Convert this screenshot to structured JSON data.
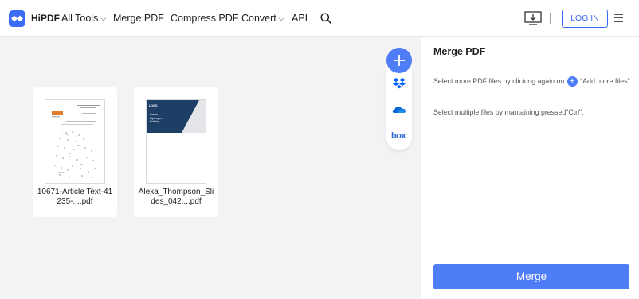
{
  "header": {
    "brand": "HiPDF",
    "nav": [
      {
        "label": "All Tools",
        "dropdown": true
      },
      {
        "label": "Merge PDF",
        "dropdown": false
      },
      {
        "label": "Compress PDF",
        "dropdown": false
      },
      {
        "label": "Convert",
        "dropdown": true
      },
      {
        "label": "API",
        "dropdown": false
      }
    ],
    "login_label": "LOG IN"
  },
  "files": [
    {
      "name": "10671-Article Text-41235-....pdf",
      "thumbnail": "document-page"
    },
    {
      "name": "Alexa_Thompson_Slides_042....pdf",
      "thumbnail": "presentation-slide",
      "slide_logo": "LOGO",
      "slide_title": "Green Hydrogen Briefing"
    }
  ],
  "upload_sources": [
    "add-more-files",
    "dropbox",
    "onedrive",
    "box"
  ],
  "upload_labels": {
    "box": "box"
  },
  "panel": {
    "title": "Merge PDF",
    "hint1_before": "Select more PDF files by clicking again on",
    "hint1_after": "\"Add more files\".",
    "hint2": "Select multiple files by mantaining pressed\"Ctrl\".",
    "merge_label": "Merge"
  },
  "colors": {
    "accent": "#4f7cf7",
    "workspace_bg": "#f3f3f5",
    "slide_navy": "#1d3f66"
  }
}
